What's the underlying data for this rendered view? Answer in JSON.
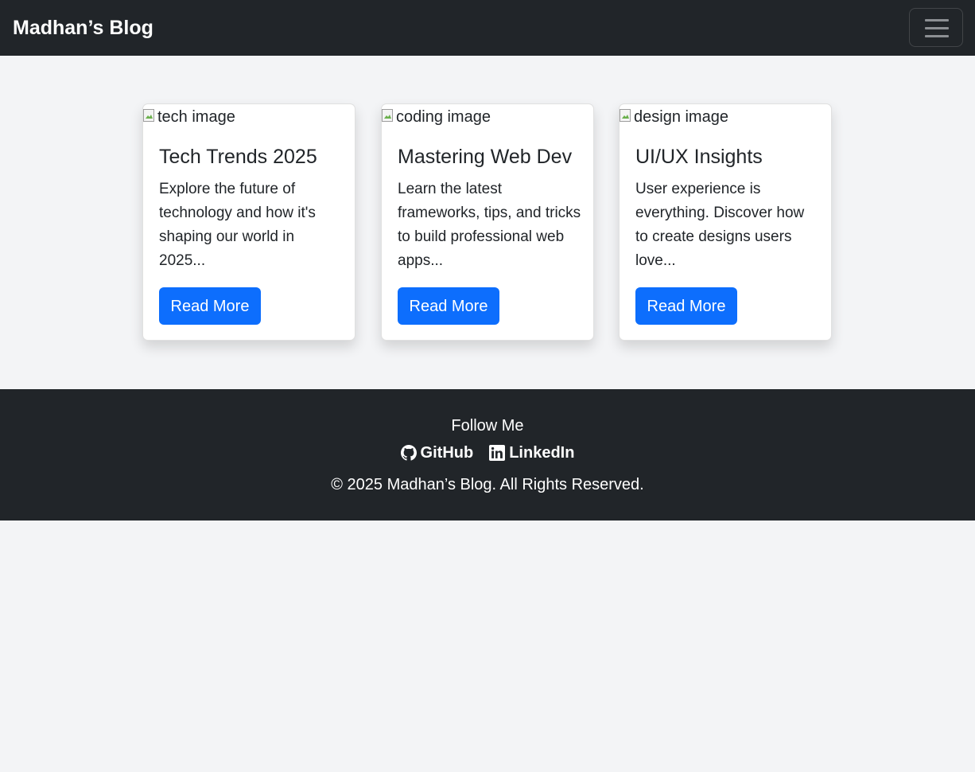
{
  "navbar": {
    "brand": "Madhan’s Blog",
    "toggler_icon": "hamburger-menu-icon"
  },
  "cards": [
    {
      "image_alt": "tech image",
      "title": "Tech Trends 2025",
      "text": "Explore the future of technology and how it's shaping our world in 2025...",
      "button": "Read More"
    },
    {
      "image_alt": "coding image",
      "title": "Mastering Web Dev",
      "text": "Learn the latest frameworks, tips, and tricks to build professional web apps...",
      "button": "Read More"
    },
    {
      "image_alt": "design image",
      "title": "UI/UX Insights",
      "text": "User experience is everything. Discover how to create designs users love...",
      "button": "Read More"
    }
  ],
  "footer": {
    "follow_label": "Follow Me",
    "links": [
      {
        "label": "GitHub",
        "icon": "github-icon"
      },
      {
        "label": "LinkedIn",
        "icon": "linkedin-icon"
      }
    ],
    "copyright": "© 2025 Madhan’s Blog. All Rights Reserved."
  },
  "colors": {
    "navbar_bg": "#212529",
    "page_bg": "#f3f4f6",
    "button_bg": "#0d6efd",
    "text": "#212529"
  }
}
